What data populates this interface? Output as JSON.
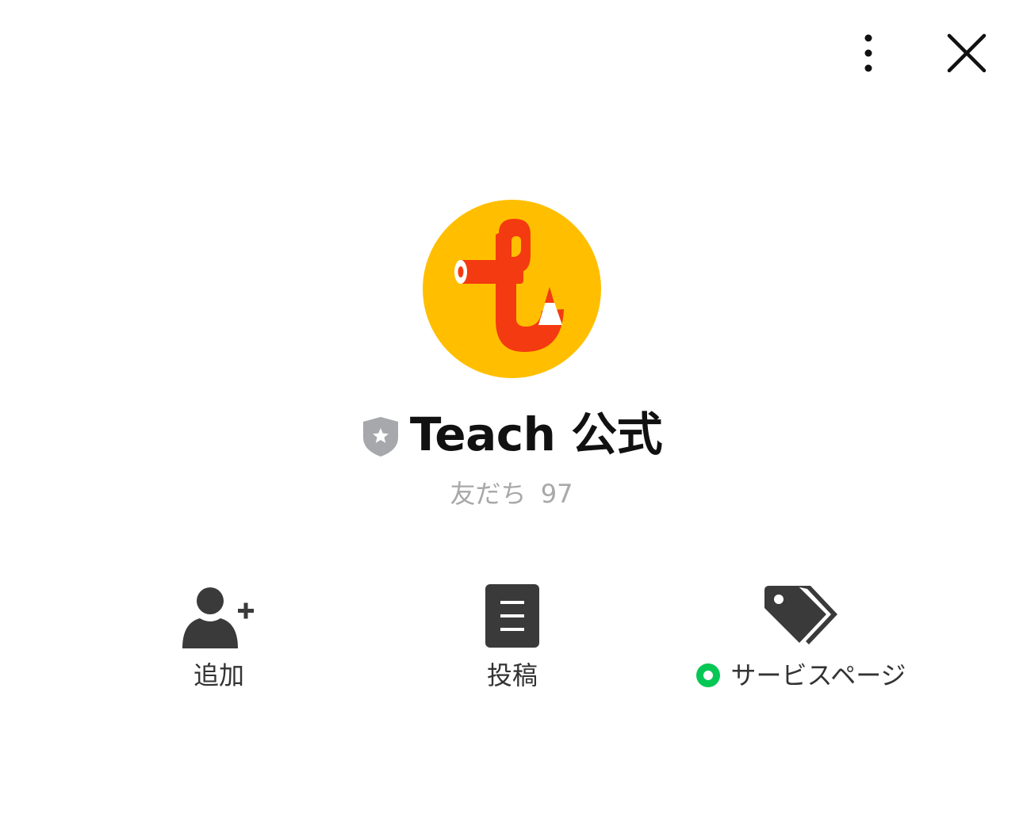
{
  "header": {
    "more_icon": "more-vertical-icon",
    "close_icon": "close-icon"
  },
  "profile": {
    "avatar_icon": "teach-logo",
    "badge_icon": "official-shield-icon",
    "name": "Teach 公式",
    "friends_label": "友だち",
    "friends_count": "97"
  },
  "actions": [
    {
      "label": "追加",
      "icon": "add-friend-icon"
    },
    {
      "label": "投稿",
      "icon": "post-document-icon"
    },
    {
      "label": "サービスページ",
      "icon": "tags-icon",
      "status_color": "#06c755"
    }
  ],
  "colors": {
    "avatar_bg": "#ffbf00",
    "logo_red": "#f43a10",
    "icon_gray": "#3a3a3a",
    "badge_gray": "#a6a8ab",
    "friends_gray": "#a8a8a8",
    "status_green": "#06c755"
  }
}
